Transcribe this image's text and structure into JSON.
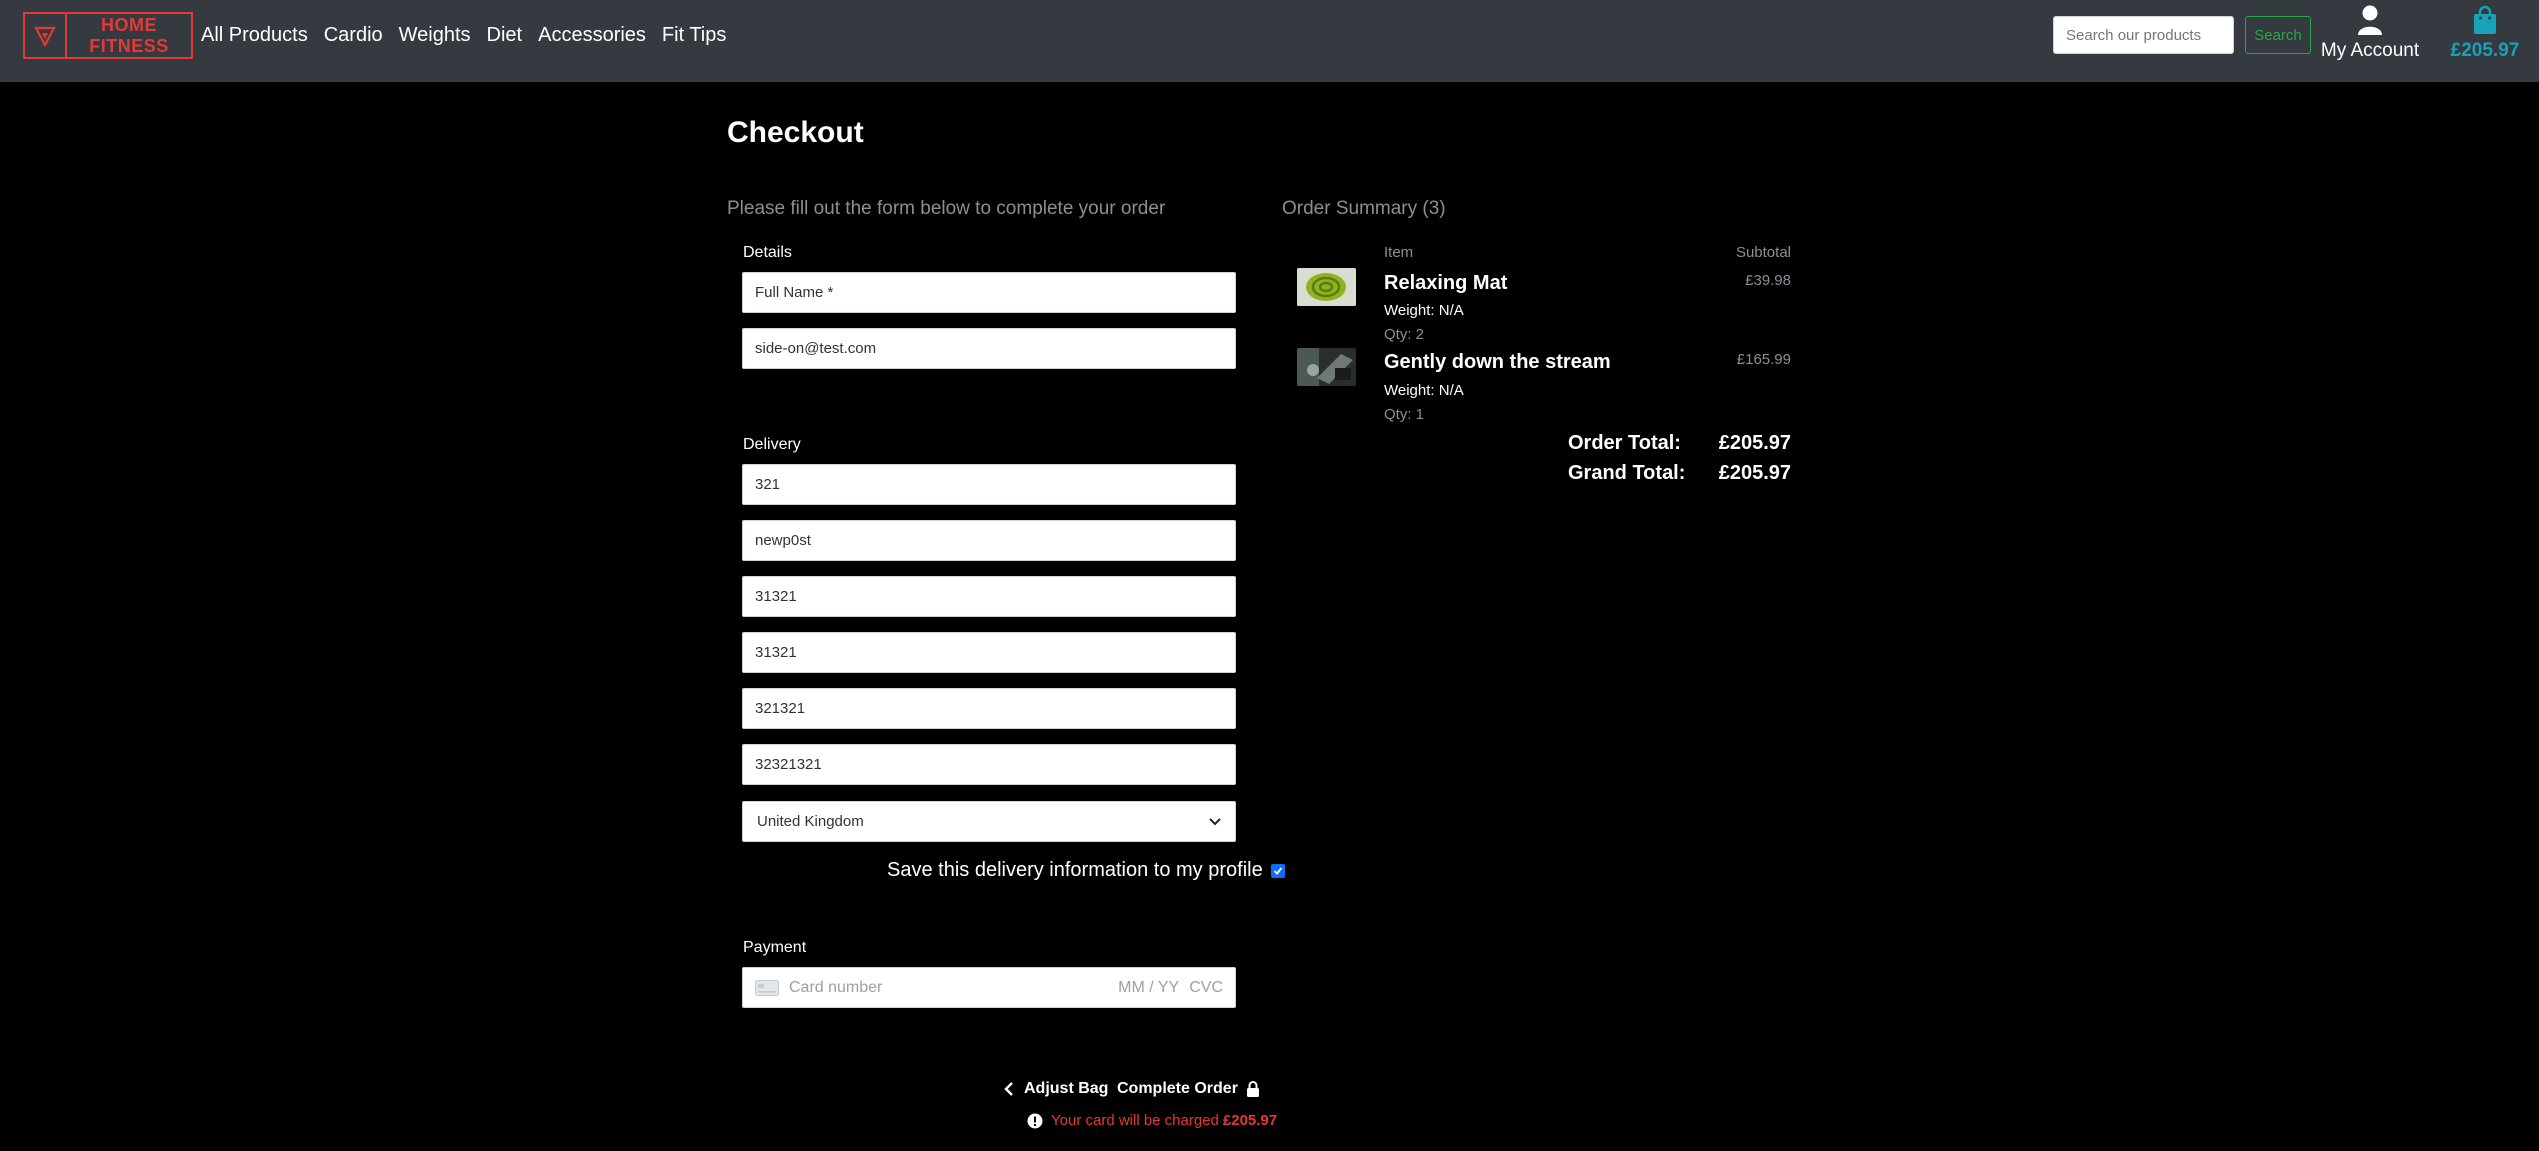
{
  "header": {
    "logo_text": "HOME FITNESS",
    "nav": [
      "All Products",
      "Cardio",
      "Weights",
      "Diet",
      "Accessories",
      "Fit Tips"
    ],
    "search_placeholder": "Search our products",
    "search_button": "Search",
    "account_label": "My Account",
    "bag_total": "£205.97"
  },
  "checkout": {
    "title": "Checkout",
    "intro": "Please fill out the form below to complete your order",
    "details_label": "Details",
    "full_name_placeholder": "Full Name *",
    "email_value": "side-on@test.com",
    "delivery_label": "Delivery",
    "delivery_fields": [
      "321",
      "newp0st",
      "31321",
      "31321",
      "321321",
      "32321321"
    ],
    "country": "United Kingdom",
    "save_info_label": "Save this delivery information to my profile",
    "save_info_checked": true,
    "payment_label": "Payment",
    "card_number_placeholder": "Card number",
    "card_expiry_placeholder": "MM / YY",
    "card_cvc_placeholder": "CVC"
  },
  "summary": {
    "title": "Order Summary (3)",
    "col_item": "Item",
    "col_subtotal": "Subtotal",
    "items": [
      {
        "name": "Relaxing Mat",
        "weight": "Weight: N/A",
        "qty": "Qty: 2",
        "subtotal": "£39.98"
      },
      {
        "name": "Gently down the stream",
        "weight": "Weight: N/A",
        "qty": "Qty: 1",
        "subtotal": "£165.99"
      }
    ],
    "order_total_label": "Order Total:",
    "order_total": "£205.97",
    "grand_total_label": "Grand Total:",
    "grand_total": "£205.97"
  },
  "actions": {
    "adjust_bag": "Adjust Bag",
    "complete_order": "Complete Order",
    "charge_text": "Your card will be charged",
    "charge_amount": "£205.97"
  },
  "colors": {
    "brand_red": "#e53935",
    "navbar": "#343a40",
    "bag_blue": "#17a2b8",
    "search_green": "#28a745"
  }
}
